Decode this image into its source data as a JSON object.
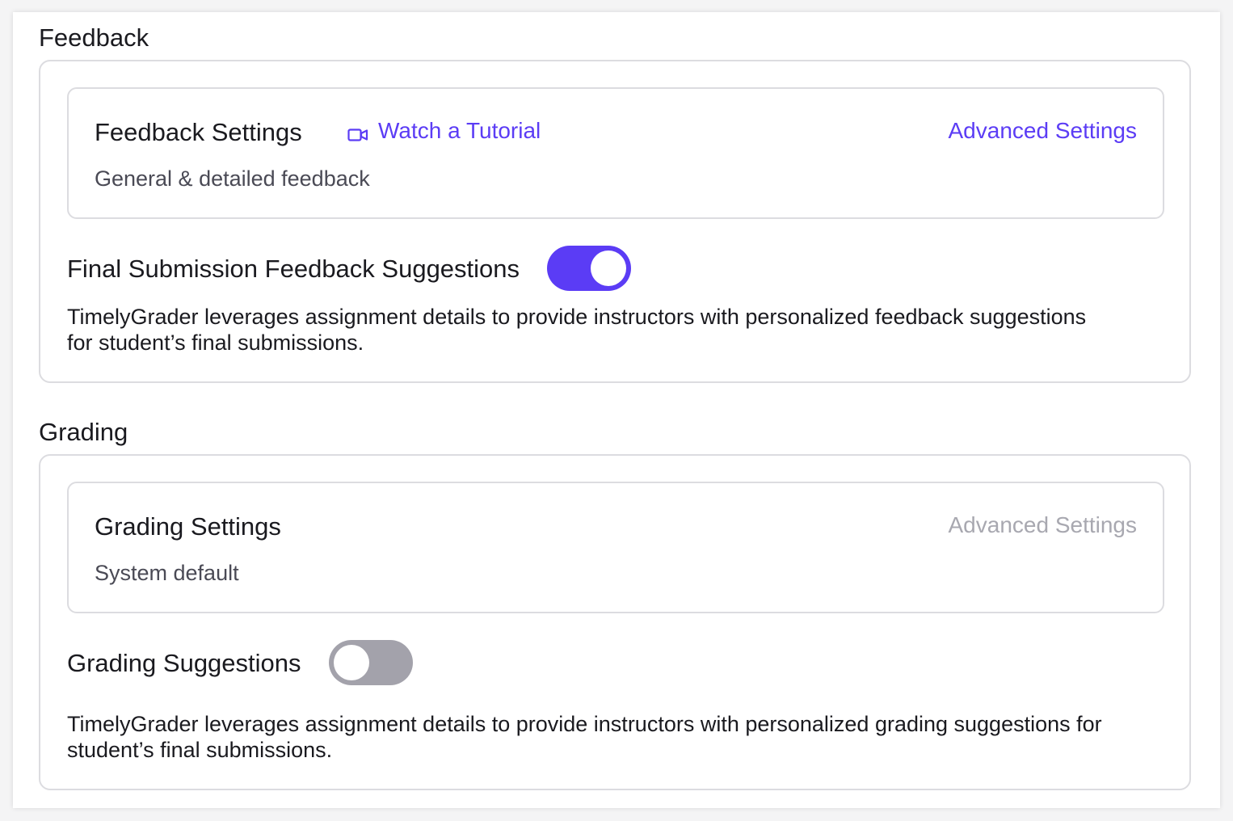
{
  "feedback": {
    "section_title": "Feedback",
    "settings_title": "Feedback Settings",
    "tutorial_label": "Watch a Tutorial",
    "tutorial_icon": "video-camera-icon",
    "advanced_label": "Advanced Settings",
    "settings_subtitle": "General & detailed feedback",
    "toggle_label": "Final Submission Feedback Suggestions",
    "toggle_on": true,
    "description": "TimelyGrader leverages assignment details to provide instructors with personalized feedback suggestions for student’s final submissions."
  },
  "grading": {
    "section_title": "Grading",
    "settings_title": "Grading Settings",
    "advanced_label": "Advanced Settings",
    "advanced_enabled": false,
    "settings_subtitle": "System default",
    "toggle_label": "Grading Suggestions",
    "toggle_on": false,
    "description": "TimelyGrader leverages assignment details to provide instructors with personalized grading suggestions for student’s final submissions."
  },
  "colors": {
    "accent": "#5b3cf5",
    "toggle_off": "#a3a2ab",
    "disabled_text": "#a8a8b0",
    "border": "#dcdce0"
  }
}
